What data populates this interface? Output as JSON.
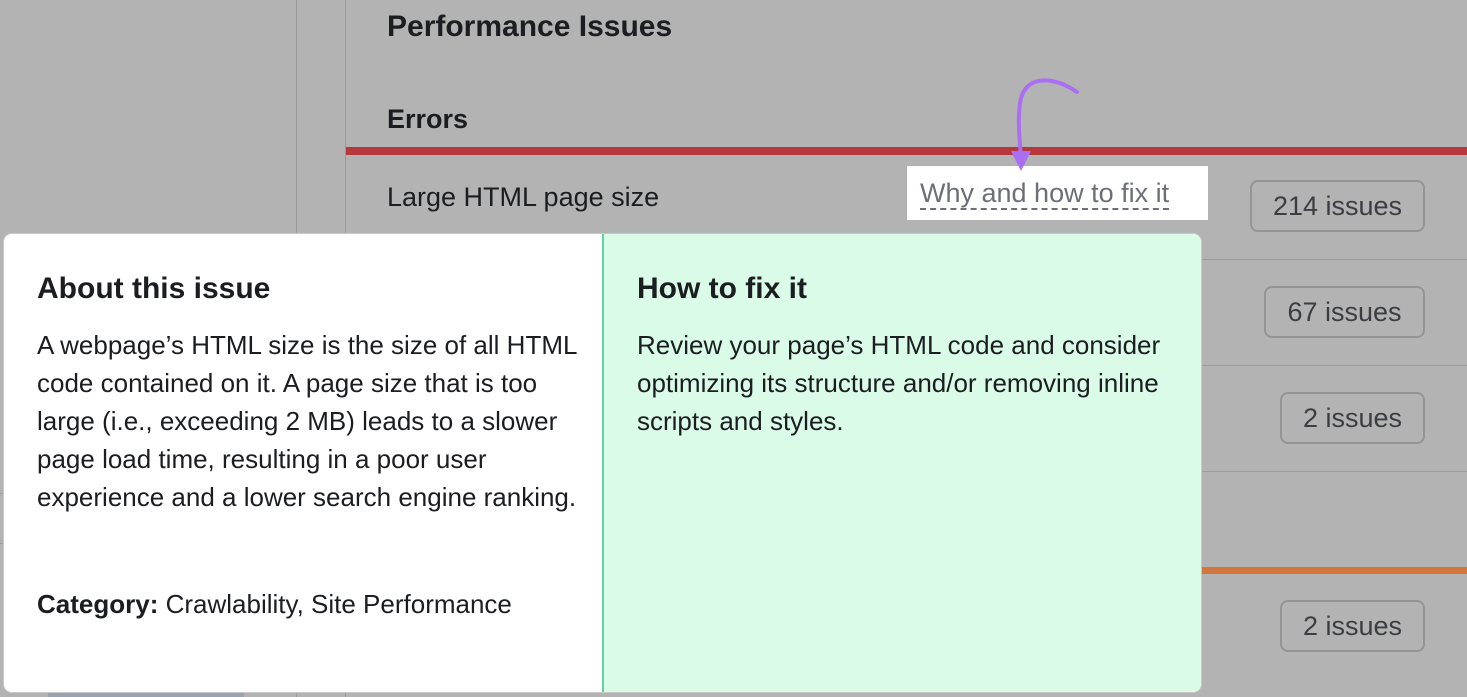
{
  "panel": {
    "title": "Performance Issues",
    "section": "Errors",
    "row_label": "Large HTML page size",
    "fix_link": "Why and how to fix it"
  },
  "badges": [
    "214 issues",
    "67 issues",
    "2 issues",
    "2 issues"
  ],
  "popup": {
    "about": {
      "title": "About this issue",
      "text": "A webpage’s HTML size is the size of all HTML code contained on it. A page size that is too large (i.e., exceeding 2 MB) leads to a slower page load time, resulting in a poor user experience and a lower search engine ranking.",
      "category_label": "Category:",
      "category_value": "Crawlability, Site Performance"
    },
    "fix": {
      "title": "How to fix it",
      "text": "Review your page’s HTML code and consider optimizing its structure and/or removing inline scripts and styles."
    }
  },
  "colors": {
    "error_bar": "#b5383d",
    "warning_bar": "#d2773b",
    "fix_background": "#d9fbe8",
    "fix_border": "#5fd3a0",
    "annotation_arrow": "#a96ef2"
  }
}
